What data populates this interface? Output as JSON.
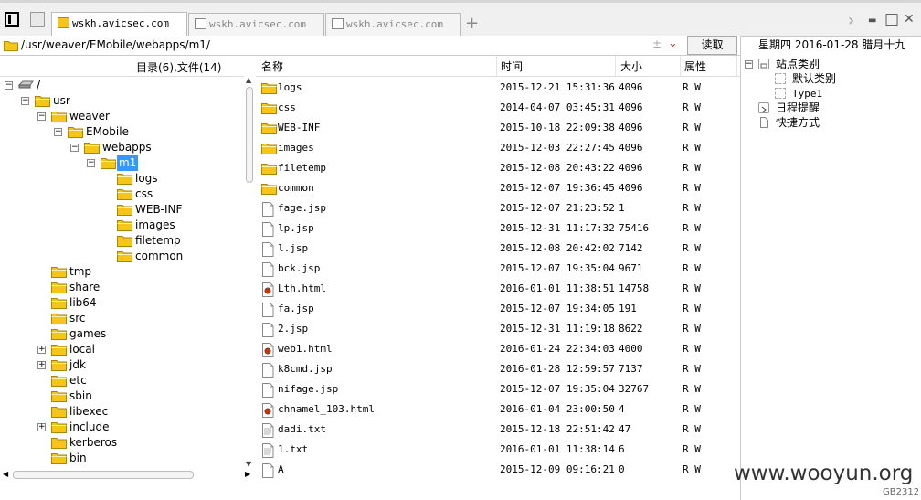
{
  "tabs": [
    {
      "label": "wskh.avicsec.com",
      "active": true
    },
    {
      "label": "wskh.avicsec.com",
      "active": false
    },
    {
      "label": "wskh.avicsec.com",
      "active": false
    }
  ],
  "tabbar": {
    "new_tab": "+",
    "forward": "›",
    "minimize": "▬",
    "maximize": "□",
    "close": "✕"
  },
  "address": {
    "path": "/usr/weaver/EMobile/webapps/m1/",
    "read_button": "读取"
  },
  "date": "星期四 2016-01-28 腊月十九",
  "tree_header": "目录(6),文件(14)",
  "tree": [
    {
      "label": "/",
      "expander": "−",
      "icon": "drive",
      "indent": 0
    },
    {
      "label": "usr",
      "expander": "−",
      "indent": 1
    },
    {
      "label": "weaver",
      "expander": "−",
      "indent": 2
    },
    {
      "label": "EMobile",
      "expander": "−",
      "indent": 3
    },
    {
      "label": "webapps",
      "expander": "−",
      "indent": 4
    },
    {
      "label": "m1",
      "expander": "−",
      "indent": 5,
      "selected": true
    },
    {
      "label": "logs",
      "expander": "",
      "indent": 6
    },
    {
      "label": "css",
      "expander": "",
      "indent": 6
    },
    {
      "label": "WEB-INF",
      "expander": "",
      "indent": 6
    },
    {
      "label": "images",
      "expander": "",
      "indent": 6
    },
    {
      "label": "filetemp",
      "expander": "",
      "indent": 6
    },
    {
      "label": "common",
      "expander": "",
      "indent": 6
    },
    {
      "label": "tmp",
      "expander": "",
      "indent": 2
    },
    {
      "label": "share",
      "expander": "",
      "indent": 2
    },
    {
      "label": "lib64",
      "expander": "",
      "indent": 2
    },
    {
      "label": "src",
      "expander": "",
      "indent": 2
    },
    {
      "label": "games",
      "expander": "",
      "indent": 2
    },
    {
      "label": "local",
      "expander": "+",
      "indent": 2
    },
    {
      "label": "jdk",
      "expander": "+",
      "indent": 2
    },
    {
      "label": "etc",
      "expander": "",
      "indent": 2
    },
    {
      "label": "sbin",
      "expander": "",
      "indent": 2
    },
    {
      "label": "libexec",
      "expander": "",
      "indent": 2
    },
    {
      "label": "include",
      "expander": "+",
      "indent": 2
    },
    {
      "label": "kerberos",
      "expander": "",
      "indent": 2
    },
    {
      "label": "bin",
      "expander": "",
      "indent": 2
    },
    {
      "label": "",
      "expander": "",
      "indent": 2
    }
  ],
  "columns": {
    "name": "名称",
    "time": "时间",
    "size": "大小",
    "attr": "属性"
  },
  "files": [
    {
      "name": "logs",
      "time": "2015-12-21 15:31:36",
      "size": "4096",
      "attr": "R W",
      "type": "folder"
    },
    {
      "name": "css",
      "time": "2014-04-07 03:45:31",
      "size": "4096",
      "attr": "R W",
      "type": "folder"
    },
    {
      "name": "WEB-INF",
      "time": "2015-10-18 22:09:38",
      "size": "4096",
      "attr": "R W",
      "type": "folder"
    },
    {
      "name": "images",
      "time": "2015-12-03 22:27:45",
      "size": "4096",
      "attr": "R W",
      "type": "folder"
    },
    {
      "name": "filetemp",
      "time": "2015-12-08 20:43:22",
      "size": "4096",
      "attr": "R W",
      "type": "folder"
    },
    {
      "name": "common",
      "time": "2015-12-07 19:36:45",
      "size": "4096",
      "attr": "R W",
      "type": "folder"
    },
    {
      "name": "fage.jsp",
      "time": "2015-12-07 21:23:52",
      "size": "1",
      "attr": "R W",
      "type": "file"
    },
    {
      "name": "lp.jsp",
      "time": "2015-12-31 11:17:32",
      "size": "75416",
      "attr": "R W",
      "type": "file"
    },
    {
      "name": "l.jsp",
      "time": "2015-12-08 20:42:02",
      "size": "7142",
      "attr": "R W",
      "type": "file"
    },
    {
      "name": "bck.jsp",
      "time": "2015-12-07 19:35:04",
      "size": "9671",
      "attr": "R W",
      "type": "file"
    },
    {
      "name": "Lth.html",
      "time": "2016-01-01 11:38:51",
      "size": "14758",
      "attr": "R W",
      "type": "html"
    },
    {
      "name": "fa.jsp",
      "time": "2015-12-07 19:34:05",
      "size": "191",
      "attr": "R W",
      "type": "file"
    },
    {
      "name": "2.jsp",
      "time": "2015-12-31 11:19:18",
      "size": "8622",
      "attr": "R W",
      "type": "file"
    },
    {
      "name": "web1.html",
      "time": "2016-01-24 22:34:03",
      "size": "4000",
      "attr": "R W",
      "type": "html"
    },
    {
      "name": "k8cmd.jsp",
      "time": "2016-01-28 12:59:57",
      "size": "7137",
      "attr": "R W",
      "type": "file"
    },
    {
      "name": "nifage.jsp",
      "time": "2015-12-07 19:35:04",
      "size": "32767",
      "attr": "R W",
      "type": "file"
    },
    {
      "name": "chnamel_103.html",
      "time": "2016-01-04 23:00:50",
      "size": "4",
      "attr": "R W",
      "type": "html"
    },
    {
      "name": "dadi.txt",
      "time": "2015-12-18 22:51:42",
      "size": "47",
      "attr": "R W",
      "type": "txt"
    },
    {
      "name": "1.txt",
      "time": "2016-01-01 11:38:14",
      "size": "6",
      "attr": "R W",
      "type": "txt"
    },
    {
      "name": "A",
      "time": "2015-12-09 09:16:21",
      "size": "0",
      "attr": "R W",
      "type": "file"
    }
  ],
  "right_panel": [
    {
      "label": "站点类别",
      "expander": "−",
      "icon": "box",
      "indent": 0
    },
    {
      "label": "默认类别",
      "expander": "",
      "icon": "dash",
      "indent": 1
    },
    {
      "label": "Type1",
      "expander": "",
      "icon": "dash",
      "indent": 1
    },
    {
      "label": "日程提醒",
      "expander": "",
      "icon": "clock",
      "indent": 0
    },
    {
      "label": "快捷方式",
      "expander": "",
      "icon": "page",
      "indent": 0
    }
  ],
  "watermark": {
    "site": "www.wooyun.org",
    "id": "GB2312"
  },
  "colors": {
    "folder": "#f5c518",
    "selection": "#3399ff",
    "html_icon": "#cc3300"
  }
}
